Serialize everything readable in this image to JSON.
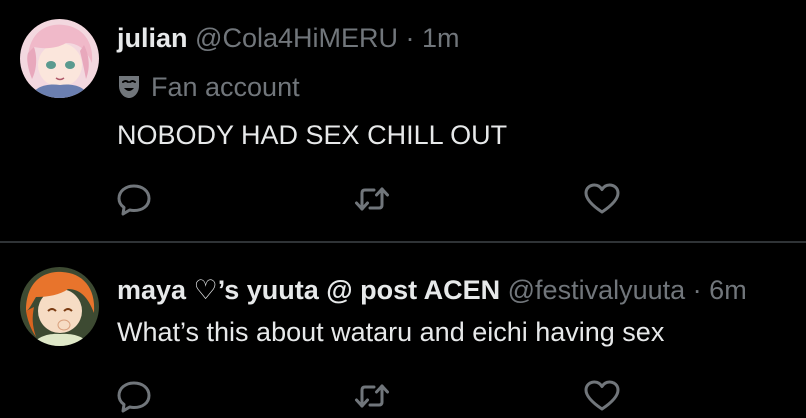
{
  "posts": [
    {
      "display_name": "julian",
      "handle": "@Cola4HiMERU",
      "separator": "·",
      "time": "1m",
      "badge_label": "Fan account",
      "badge_icon": "mask-icon",
      "text": "NOBODY HAD SEX CHILL OUT",
      "actions": [
        "reply-icon",
        "retweet-icon",
        "like-icon"
      ]
    },
    {
      "display_name": "maya ♡’s yuuta @ post ACEN",
      "handle": "@festivalyuuta",
      "separator": "·",
      "time": "6m",
      "text": "What’s this about wataru and eichi having sex",
      "actions": [
        "reply-icon",
        "retweet-icon",
        "like-icon"
      ]
    }
  ],
  "colors": {
    "background": "#000000",
    "text": "#e7e9ea",
    "secondary": "#71767b",
    "divider": "#2f3336"
  }
}
